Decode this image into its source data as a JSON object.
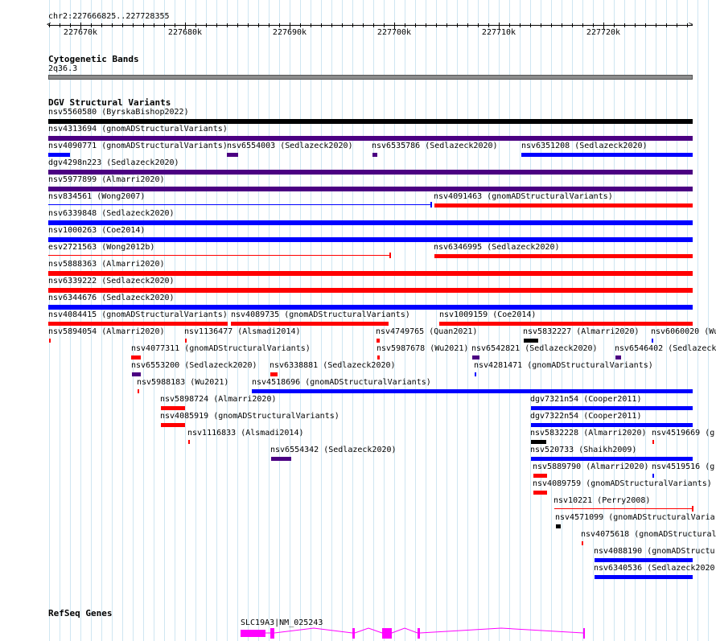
{
  "location": "chr2:227666825..227728355",
  "ruler": {
    "ticks": [
      "227670k",
      "227680k",
      "227690k",
      "227700k",
      "227710k",
      "227720k"
    ]
  },
  "colors": {
    "gain": "#0000ff",
    "loss": "#ff0000",
    "complex": "#4b0082",
    "other": "#000000",
    "gene": "#ff00ff",
    "band": "#8c8c8c",
    "grid": "#cfe6f2"
  },
  "tracks": {
    "cyto": {
      "title": "Cytogenetic Bands",
      "band": "2q36.3"
    },
    "dgv": {
      "title": "DGV Structural Variants",
      "features": [
        {
          "label": "nsv5560580 (ByrskaBishop2022)",
          "type": "other"
        },
        {
          "label": "nsv4313694 (gnomADStructuralVariants)",
          "type": "complex"
        },
        {
          "label": "nsv4090771 (gnomADStructuralVariants)",
          "type": "gain"
        },
        {
          "label": "nsv6554003 (Sedlazeck2020)",
          "type": "complex"
        },
        {
          "label": "nsv6535786 (Sedlazeck2020)",
          "type": "complex"
        },
        {
          "label": "nsv6351208 (Sedlazeck2020)",
          "type": "gain"
        },
        {
          "label": "dgv4298n223 (Sedlazeck2020)",
          "type": "complex"
        },
        {
          "label": "nsv5977899 (Almarri2020)",
          "type": "complex"
        },
        {
          "label": "nsv834561 (Wong2007)",
          "type": "gain"
        },
        {
          "label": "nsv4091463 (gnomADStructuralVariants)",
          "type": "loss"
        },
        {
          "label": "nsv6339848 (Sedlazeck2020)",
          "type": "gain"
        },
        {
          "label": "nsv1000263 (Coe2014)",
          "type": "gain"
        },
        {
          "label": "esv2721563 (Wong2012b)",
          "type": "loss"
        },
        {
          "label": "nsv6346995 (Sedlazeck2020)",
          "type": "loss"
        },
        {
          "label": "nsv5888363 (Almarri2020)",
          "type": "loss"
        },
        {
          "label": "nsv6339222 (Sedlazeck2020)",
          "type": "loss"
        },
        {
          "label": "nsv6344676 (Sedlazeck2020)",
          "type": "gain"
        },
        {
          "label": "nsv4084415 (gnomADStructuralVariants)",
          "type": "loss"
        },
        {
          "label": "nsv4089735 (gnomADStructuralVariants)",
          "type": "loss"
        },
        {
          "label": "nsv1009159 (Coe2014)",
          "type": "loss"
        },
        {
          "label": "nsv5894054 (Almarri2020)",
          "type": "loss"
        },
        {
          "label": "nsv1136477 (Alsmadi2014)",
          "type": "loss"
        },
        {
          "label": "nsv4749765 (Quan2021)",
          "type": "loss"
        },
        {
          "label": "nsv5832227 (Almarri2020)",
          "type": "other"
        },
        {
          "label": "nsv6060020 (Wu",
          "type": "gain"
        },
        {
          "label": "nsv4077311 (gnomADStructuralVariants)",
          "type": "loss"
        },
        {
          "label": "nsv5987678 (Wu2021)",
          "type": "loss"
        },
        {
          "label": "nsv6542821 (Sedlazeck2020)",
          "type": "complex"
        },
        {
          "label": "nsv6546402 (Sedlazeck",
          "type": "complex"
        },
        {
          "label": "nsv6553200 (Sedlazeck2020)",
          "type": "complex"
        },
        {
          "label": "nsv6338881 (Sedlazeck2020)",
          "type": "loss"
        },
        {
          "label": "nsv4281471 (gnomADStructuralVariants)",
          "type": "gain"
        },
        {
          "label": "nsv5988183 (Wu2021)",
          "type": "loss"
        },
        {
          "label": "nsv4518696 (gnomADStructuralVariants)",
          "type": "gain"
        },
        {
          "label": "nsv5898724 (Almarri2020)",
          "type": "loss"
        },
        {
          "label": "dgv7321n54 (Cooper2011)",
          "type": "gain"
        },
        {
          "label": "nsv4085919 (gnomADStructuralVariants)",
          "type": "loss"
        },
        {
          "label": "dgv7322n54 (Cooper2011)",
          "type": "gain"
        },
        {
          "label": "nsv1116833 (Alsmadi2014)",
          "type": "loss"
        },
        {
          "label": "nsv5832228 (Almarri2020)",
          "type": "other"
        },
        {
          "label": "nsv4519669 (g",
          "type": "loss"
        },
        {
          "label": "nsv6554342 (Sedlazeck2020)",
          "type": "complex"
        },
        {
          "label": "nsv520733 (Shaikh2009)",
          "type": "gain"
        },
        {
          "label": "nsv5889790 (Almarri2020)",
          "type": "loss"
        },
        {
          "label": "nsv4519516 (g",
          "type": "gain"
        },
        {
          "label": "nsv4089759 (gnomADStructuralVariants)",
          "type": "loss"
        },
        {
          "label": "nsv10221 (Perry2008)",
          "type": "loss"
        },
        {
          "label": "nsv4571099 (gnomADStructuralVaria",
          "type": "other"
        },
        {
          "label": "nsv4075618 (gnomADStructural",
          "type": "loss"
        },
        {
          "label": "nsv4088190 (gnomADStructur",
          "type": "gain"
        },
        {
          "label": "nsv6340536 (Sedlazeck2020",
          "type": "gain"
        }
      ]
    },
    "refseq": {
      "title": "RefSeq Genes",
      "gene_label": "SLC19A3|NM_025243"
    }
  }
}
